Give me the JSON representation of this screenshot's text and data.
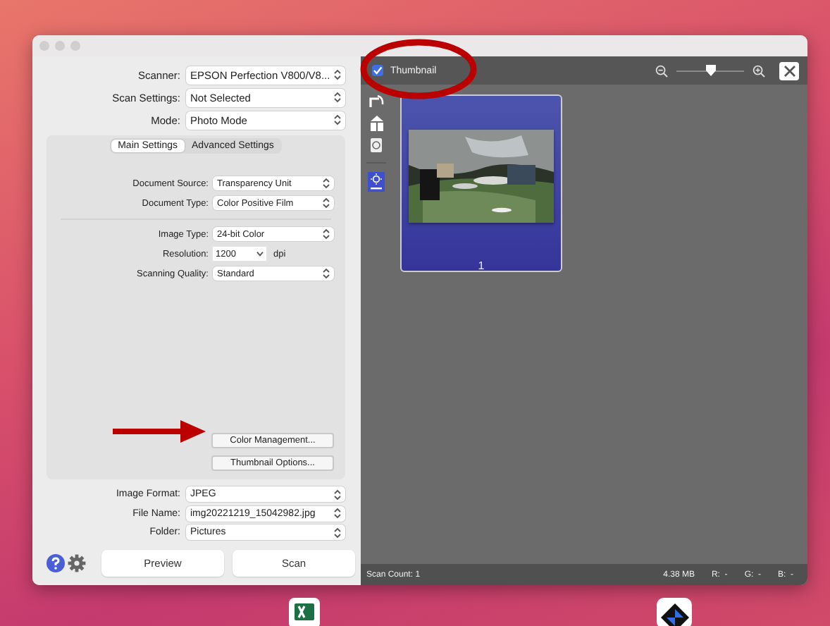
{
  "scanner_panel": {
    "top_fields": [
      {
        "label": "Scanner:",
        "value": "EPSON Perfection V800/V8..."
      },
      {
        "label": "Scan Settings:",
        "value": "Not Selected"
      },
      {
        "label": "Mode:",
        "value": "Photo Mode"
      }
    ],
    "tabs": [
      {
        "label": "Main Settings",
        "selected": true
      },
      {
        "label": "Advanced Settings",
        "selected": false
      }
    ],
    "settings": [
      {
        "kind": "select",
        "label": "Document Source:",
        "value": "Transparency Unit"
      },
      {
        "kind": "select",
        "label": "Document Type:",
        "value": "Color Positive Film"
      },
      {
        "kind": "divider"
      },
      {
        "kind": "select",
        "label": "Image Type:",
        "value": "24-bit Color"
      },
      {
        "kind": "combo",
        "label": "Resolution:",
        "value": "1200",
        "unit": "dpi"
      },
      {
        "kind": "select",
        "label": "Scanning Quality:",
        "value": "Standard"
      }
    ],
    "option_buttons": [
      "Color Management...",
      "Thumbnail Options..."
    ],
    "output_fields": [
      {
        "label": "Image Format:",
        "value": "JPEG"
      },
      {
        "label": "File Name:",
        "value": "img20221219_15042982.jpg"
      },
      {
        "label": "Folder:",
        "value": "Pictures"
      }
    ],
    "action_buttons": [
      "Preview",
      "Scan"
    ]
  },
  "preview_panel": {
    "thumbnail_toggle": {
      "label": "Thumbnail",
      "checked": true
    },
    "zoom": {
      "level": 0.5
    },
    "thumbnails": [
      {
        "number": "1",
        "selected": true,
        "kind": "picture"
      }
    ],
    "status_bar": {
      "scan_count": "Scan Count: 1",
      "size": "4.38 MB",
      "channels": [
        "R:  -",
        "G:  -",
        "B:  -"
      ]
    }
  }
}
